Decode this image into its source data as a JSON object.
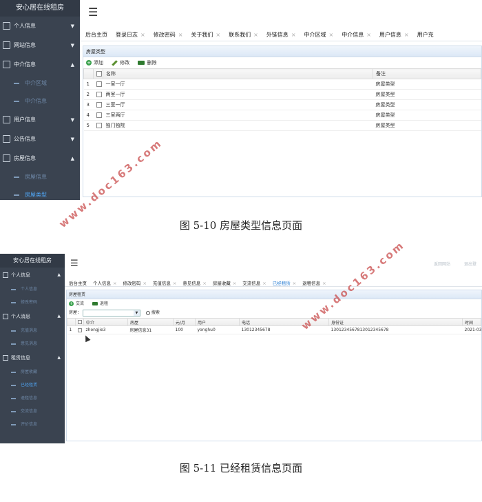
{
  "shot1": {
    "sidebar": {
      "title": "安心居在线租房",
      "items": [
        {
          "label": "个人信息",
          "icon": "grid-icon",
          "arrow": "▼",
          "subs": []
        },
        {
          "label": "网站信息",
          "icon": "menu-icon",
          "arrow": "▼",
          "subs": []
        },
        {
          "label": "中介信息",
          "icon": "menu-icon",
          "arrow": "▲",
          "subs": [
            {
              "label": "中介区域",
              "active": false
            },
            {
              "label": "中介信息",
              "active": false
            }
          ]
        },
        {
          "label": "用户信息",
          "icon": "menu-icon",
          "arrow": "▼",
          "subs": []
        },
        {
          "label": "公告信息",
          "icon": "menu-icon",
          "arrow": "▼",
          "subs": []
        },
        {
          "label": "房屋信息",
          "icon": "menu-icon",
          "arrow": "▲",
          "subs": [
            {
              "label": "房屋信息",
              "active": false
            },
            {
              "label": "房屋类型",
              "active": true
            }
          ]
        }
      ]
    },
    "tabs": [
      "后台主页",
      "登录日志",
      "修改密码",
      "关于我们",
      "联系我们",
      "外链信息",
      "中介区域",
      "中介信息",
      "用户信息",
      "用户充"
    ],
    "panel_title": "房屋类型",
    "toolbar": {
      "add": "添加",
      "edit": "修改",
      "delete": "删除"
    },
    "columns": {
      "name": "名称",
      "note": "备注"
    },
    "rows": [
      {
        "no": "1",
        "name": "一室一厅",
        "note": "房屋类型"
      },
      {
        "no": "2",
        "name": "两室一厅",
        "note": "房屋类型"
      },
      {
        "no": "3",
        "name": "三室一厅",
        "note": "房屋类型"
      },
      {
        "no": "4",
        "name": "三室两厅",
        "note": "房屋类型"
      },
      {
        "no": "5",
        "name": "独门独院",
        "note": "房屋类型"
      }
    ]
  },
  "caption1": "图 5-10 房屋类型信息页面",
  "shot2": {
    "sidebar": {
      "title": "安心居在线租房",
      "items": [
        {
          "label": "个人信息",
          "arrow": "▲",
          "subs": [
            {
              "label": "个人信息",
              "active": false
            },
            {
              "label": "修改密码",
              "active": false
            }
          ]
        },
        {
          "label": "个人消息",
          "arrow": "▲",
          "subs": [
            {
              "label": "充值消息",
              "active": false
            },
            {
              "label": "意见消息",
              "active": false
            }
          ]
        },
        {
          "label": "租赁信息",
          "arrow": "▲",
          "subs": [
            {
              "label": "房屋收藏",
              "active": false
            },
            {
              "label": "已经租赁",
              "active": true
            },
            {
              "label": "退租信息",
              "active": false
            },
            {
              "label": "交流信息",
              "active": false
            },
            {
              "label": "评价信息",
              "active": false
            }
          ]
        }
      ]
    },
    "topright": [
      "返回网站",
      "退出登"
    ],
    "tabs": [
      {
        "label": "后台主页",
        "active": false
      },
      {
        "label": "个人信息",
        "active": false
      },
      {
        "label": "修改密码",
        "active": false
      },
      {
        "label": "充值信息",
        "active": false
      },
      {
        "label": "意见信息",
        "active": false
      },
      {
        "label": "房屋收藏",
        "active": false
      },
      {
        "label": "交流信息",
        "active": false
      },
      {
        "label": "已经租赁",
        "active": true
      },
      {
        "label": "退租信息",
        "active": false
      }
    ],
    "panel_title": "房屋租赁",
    "toolbar": {
      "exchange": "交流",
      "refund": "退租"
    },
    "filter": {
      "label": "房屋：",
      "search": "搜索"
    },
    "columns": [
      "中介",
      "房屋",
      "元/月",
      "用户",
      "电话",
      "身份证",
      "时间"
    ],
    "rows": [
      {
        "no": "1",
        "agent": "zhongjie3",
        "house": "房屋信息31",
        "price": "100",
        "user": "yonghu0",
        "phone": "13012345678",
        "id": "13012345678130123456​78",
        "time": "2021-03-"
      }
    ]
  },
  "caption2": "图 5-11 已经租赁信息页面",
  "watermark": "www.doc163.com",
  "colors": {
    "sidebar": "#3a4350",
    "active_sub": "#4fa3f0",
    "active_tab": "#2b7fd4",
    "watermark": "#c84646"
  }
}
